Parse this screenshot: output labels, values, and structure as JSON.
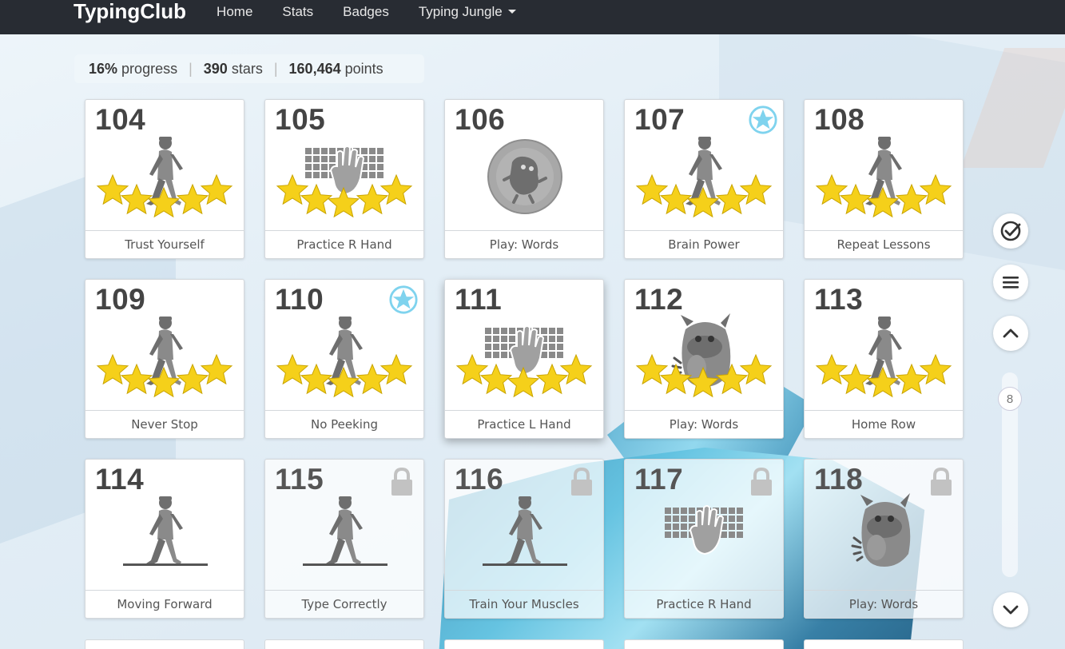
{
  "nav": {
    "brand": "TypingClub",
    "items": [
      "Home",
      "Stats",
      "Badges",
      "Typing Jungle"
    ]
  },
  "stats": {
    "progress_value": "16%",
    "progress_label": "progress",
    "stars_value": "390",
    "stars_label": "stars",
    "points_value": "160,464",
    "points_label": "points",
    "separator": "|"
  },
  "lessons": [
    {
      "num": "104",
      "title": "Trust Yourself",
      "art": "walker-icon",
      "stars": 5,
      "locked": false,
      "badge": false
    },
    {
      "num": "105",
      "title": "Practice R Hand",
      "art": "keyboard-hand-icon",
      "stars": 5,
      "locked": false,
      "badge": false
    },
    {
      "num": "106",
      "title": "Play: Words",
      "art": "game-ball-icon",
      "stars": 0,
      "locked": false,
      "badge": false
    },
    {
      "num": "107",
      "title": "Brain Power",
      "art": "walker-icon",
      "stars": 5,
      "locked": false,
      "badge": true
    },
    {
      "num": "108",
      "title": "Repeat Lessons",
      "art": "walker-icon",
      "stars": 5,
      "locked": false,
      "badge": false
    },
    {
      "num": "109",
      "title": "Never Stop",
      "art": "walker-icon",
      "stars": 5,
      "locked": false,
      "badge": false
    },
    {
      "num": "110",
      "title": "No Peeking",
      "art": "walker-icon",
      "stars": 5,
      "locked": false,
      "badge": true
    },
    {
      "num": "111",
      "title": "Practice L Hand",
      "art": "keyboard-hand-icon",
      "stars": 5,
      "locked": false,
      "badge": false
    },
    {
      "num": "112",
      "title": "Play: Words",
      "art": "monster-icon",
      "stars": 5,
      "locked": false,
      "badge": false
    },
    {
      "num": "113",
      "title": "Home Row",
      "art": "walker-icon",
      "stars": 5,
      "locked": false,
      "badge": false
    },
    {
      "num": "114",
      "title": "Moving Forward",
      "art": "walker-line-icon",
      "stars": 0,
      "locked": false,
      "badge": false
    },
    {
      "num": "115",
      "title": "Type Correctly",
      "art": "walker-line-icon",
      "stars": 0,
      "locked": true,
      "badge": false
    },
    {
      "num": "116",
      "title": "Train Your Muscles",
      "art": "walker-line-icon",
      "stars": 0,
      "locked": true,
      "badge": false
    },
    {
      "num": "117",
      "title": "Practice R Hand",
      "art": "keyboard-hand-icon",
      "stars": 0,
      "locked": true,
      "badge": false
    },
    {
      "num": "118",
      "title": "Play: Words",
      "art": "monster-icon",
      "stars": 0,
      "locked": true,
      "badge": false
    }
  ],
  "sidebar": {
    "check_icon": "check-circle-icon",
    "menu_icon": "menu-icon",
    "up_icon": "chevron-up-icon",
    "down_icon": "chevron-down-icon",
    "scroll_position": "8"
  },
  "colors": {
    "topbar": "#282c33",
    "star": "#f5d01a",
    "badge": "#7fd3ee",
    "icon_gray": "#8a8a8a"
  }
}
